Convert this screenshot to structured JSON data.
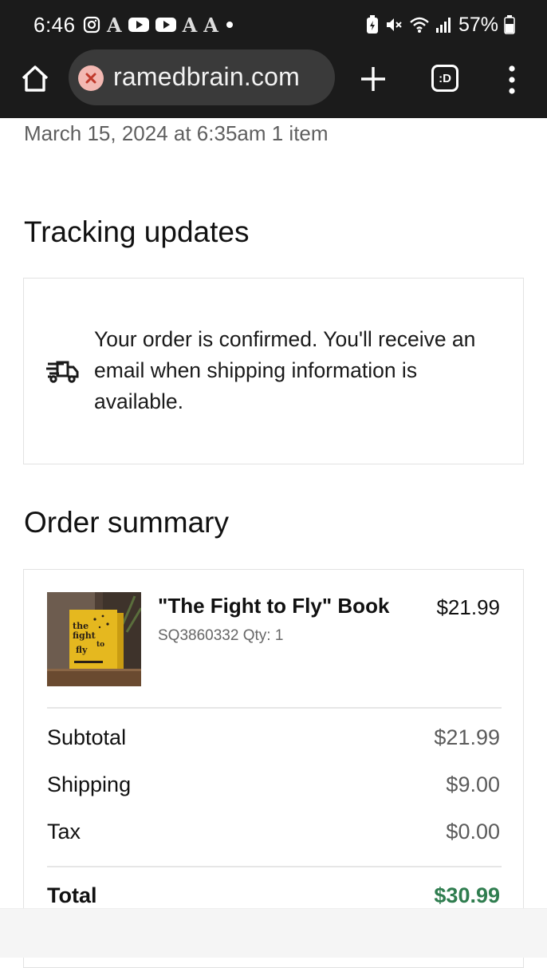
{
  "status_bar": {
    "time": "6:46",
    "battery": "57%",
    "left_icons": [
      "instagram-icon",
      "A",
      "youtube-icon",
      "youtube-icon",
      "A",
      "A",
      "dot-icon"
    ],
    "right_icons": [
      "battery-saver-icon",
      "mute-icon",
      "wifi-icon",
      "signal-icon",
      "battery-icon"
    ]
  },
  "browser": {
    "url": "ramedbrain.com",
    "tabs_count": ":D",
    "icons": {
      "home": "home-icon",
      "site": "blocked-site-icon",
      "new_tab": "plus-icon",
      "menu": "more-vert-icon"
    }
  },
  "order": {
    "meta": "March 15, 2024 at 6:35am 1 item"
  },
  "tracking": {
    "heading": "Tracking updates",
    "message": "Your order is confirmed. You'll receive an email when shipping information is available.",
    "icon": "delivery-truck-icon"
  },
  "summary": {
    "heading": "Order summary",
    "item": {
      "title": "\"The Fight to Fly\" Book",
      "sku_qty": "SQ3860332 Qty: 1",
      "price": "$21.99",
      "thumb_icon": "book-cover-image"
    },
    "rows": [
      {
        "label": "Subtotal",
        "value": "$21.99"
      },
      {
        "label": "Shipping",
        "value": "$9.00"
      },
      {
        "label": "Tax",
        "value": "$0.00"
      }
    ],
    "total": {
      "label": "Total",
      "value": "$30.99"
    },
    "colors": {
      "total": "#2f7d4f",
      "text": "#111111",
      "muted": "#5b5b5b"
    }
  }
}
